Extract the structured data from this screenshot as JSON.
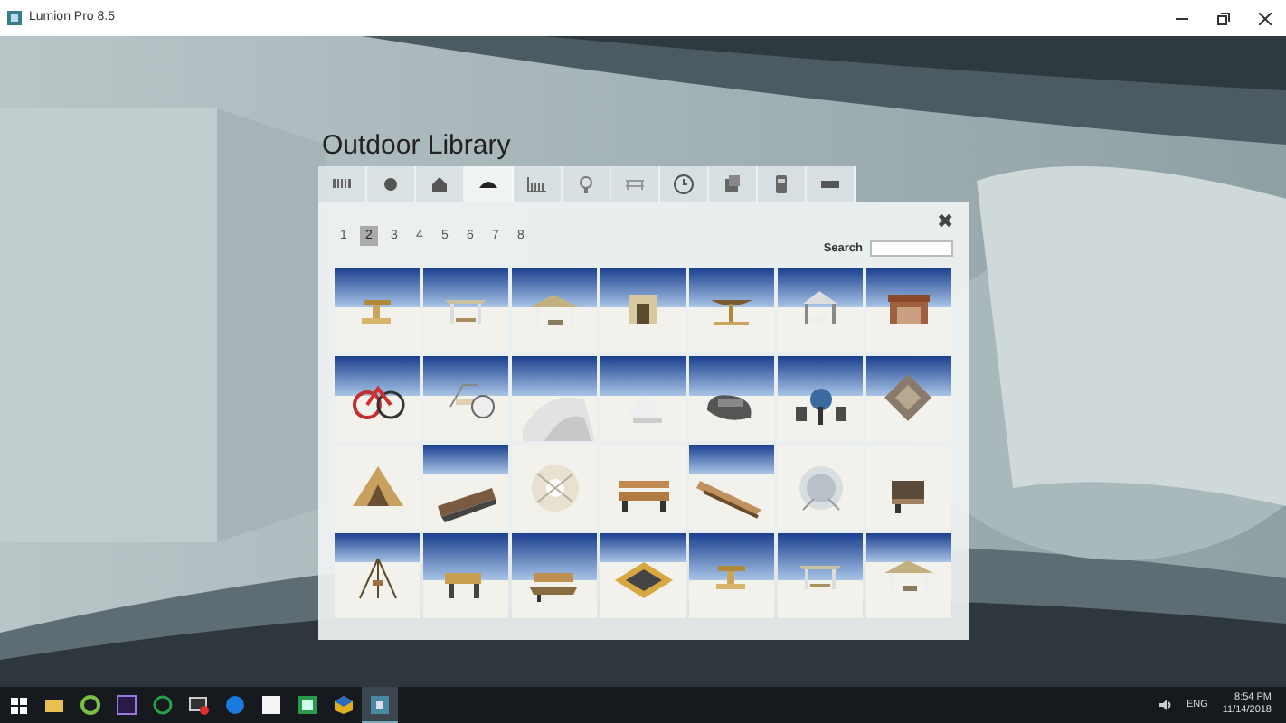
{
  "window": {
    "title": "Lumion Pro 8.5"
  },
  "library": {
    "title": "Outdoor Library",
    "tabs": [
      {
        "kind": "fence",
        "selected": false
      },
      {
        "kind": "ball",
        "selected": false
      },
      {
        "kind": "house",
        "selected": false
      },
      {
        "kind": "canopy",
        "selected": true
      },
      {
        "kind": "rack",
        "selected": false
      },
      {
        "kind": "lamp",
        "selected": false
      },
      {
        "kind": "bench",
        "selected": false
      },
      {
        "kind": "clock",
        "selected": false
      },
      {
        "kind": "crate",
        "selected": false
      },
      {
        "kind": "bin",
        "selected": false
      },
      {
        "kind": "tray",
        "selected": false
      }
    ],
    "pages": [
      {
        "label": "1",
        "selected": false
      },
      {
        "label": "2",
        "selected": true
      },
      {
        "label": "3",
        "selected": false
      },
      {
        "label": "4",
        "selected": false
      },
      {
        "label": "5",
        "selected": false
      },
      {
        "label": "6",
        "selected": false
      },
      {
        "label": "7",
        "selected": false
      },
      {
        "label": "8",
        "selected": false
      }
    ],
    "close": "✖",
    "search": {
      "label": "Search"
    }
  },
  "taskbar": {
    "apps": [
      {
        "kind": "files",
        "selected": false
      },
      {
        "kind": "ring",
        "selected": false
      },
      {
        "kind": "square",
        "selected": false
      },
      {
        "kind": "power",
        "selected": false
      },
      {
        "kind": "screen",
        "selected": false
      },
      {
        "kind": "globe",
        "selected": false
      },
      {
        "kind": "page",
        "selected": false
      },
      {
        "kind": "sheet",
        "selected": false
      },
      {
        "kind": "cube",
        "selected": false
      },
      {
        "kind": "lumion",
        "selected": true
      }
    ],
    "language": "ENG",
    "time": "8:54 PM",
    "date": "11/14/2018"
  }
}
